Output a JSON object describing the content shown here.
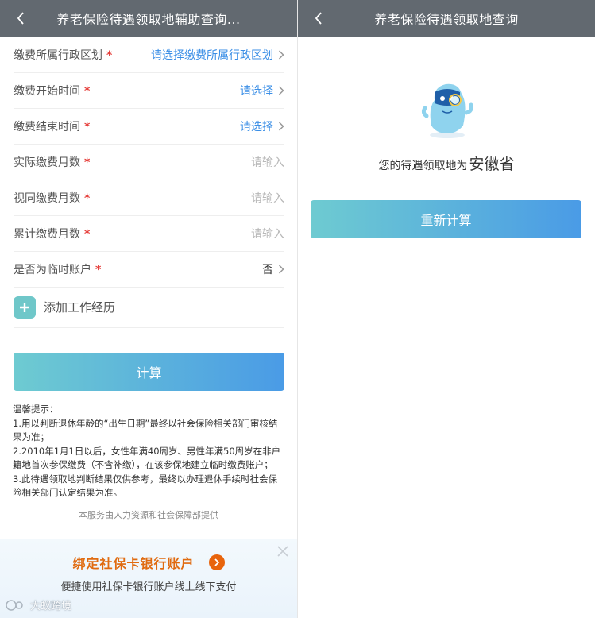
{
  "left": {
    "header": {
      "title": "养老保险待遇领取地辅助查询..."
    },
    "form": [
      {
        "label": "缴费所属行政区划",
        "value": "请选择缴费所属行政区划",
        "kind": "link"
      },
      {
        "label": "缴费开始时间",
        "value": "请选择",
        "kind": "link"
      },
      {
        "label": "缴费结束时间",
        "value": "请选择",
        "kind": "link"
      },
      {
        "label": "实际缴费月数",
        "value": "请输入",
        "kind": "placeholder"
      },
      {
        "label": "视同缴费月数",
        "value": "请输入",
        "kind": "placeholder"
      },
      {
        "label": "累计缴费月数",
        "value": "请输入",
        "kind": "placeholder"
      },
      {
        "label": "是否为临时账户",
        "value": "否",
        "kind": "value"
      }
    ],
    "required_mark": "*",
    "add_work": {
      "label": "添加工作经历"
    },
    "calc_button": "计算",
    "tips": {
      "heading": "温馨提示：",
      "items": [
        "1.用以判断退休年龄的“出生日期”最终以社会保险相关部门审核结果为准；",
        "2.2010年1月1日以后，女性年满40周岁、男性年满50周岁在非户籍地首次参保缴费（不含补缴），在该参保地建立临时缴费账户；",
        "3.此待遇领取地判断结果仅供参考，最终以办理退休手续时社会保险相关部门认定结果为准。"
      ]
    },
    "provider": "本服务由人力资源和社会保障部提供",
    "banner": {
      "title": "绑定社保卡银行账户",
      "subtitle": "便捷使用社保卡银行账户线上线下支付"
    },
    "watermark": "大蚁跨境"
  },
  "right": {
    "header": {
      "title": "养老保险待遇领取地查询"
    },
    "result_prefix": "您的待遇领取地为",
    "result_place": "安徽省",
    "recalc_button": "重新计算"
  },
  "colors": {
    "navbar": "#626970",
    "link": "#3a8ee6",
    "required": "#e53935",
    "banner_accent": "#e06b10",
    "button_gradient_start": "#6ecbd1",
    "button_gradient_end": "#4a9be6"
  },
  "icons": [
    "back-arrow-icon",
    "chevron-right-icon",
    "plus-icon",
    "close-icon",
    "arrow-right-circle-icon",
    "mascot-icon"
  ]
}
